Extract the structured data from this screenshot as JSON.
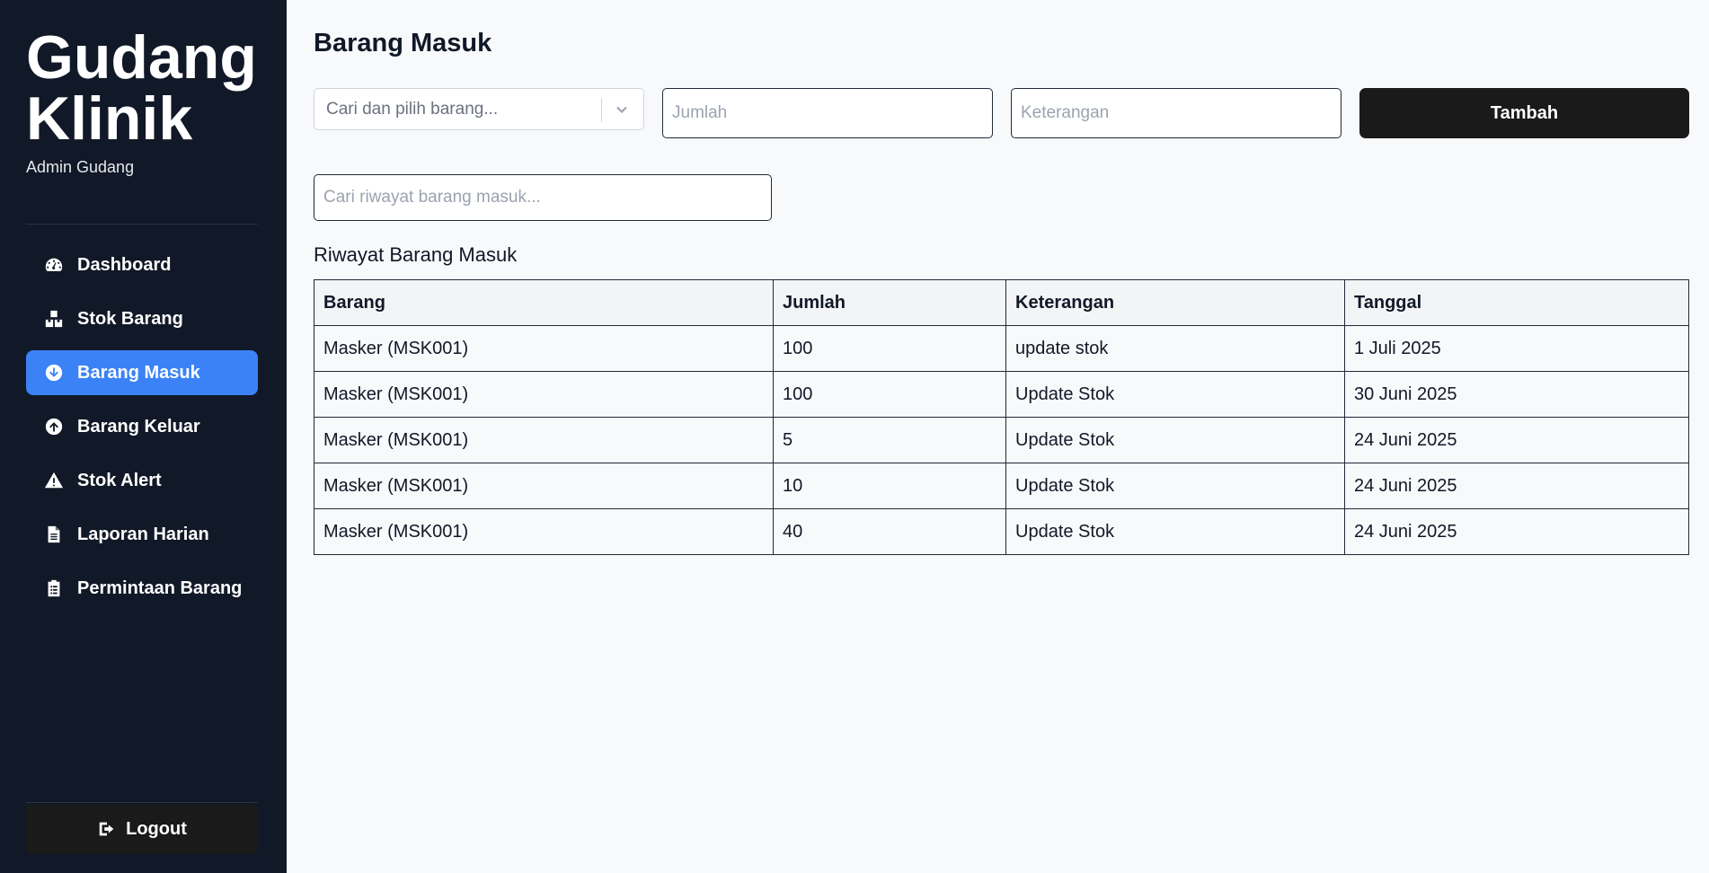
{
  "sidebar": {
    "brand_line1": "Gudang",
    "brand_line2": "Klinik",
    "role": "Admin Gudang",
    "items": [
      {
        "label": "Dashboard",
        "icon": "dashboard-icon"
      },
      {
        "label": "Stok Barang",
        "icon": "boxes-icon"
      },
      {
        "label": "Barang Masuk",
        "icon": "arrow-circle-down-icon",
        "active": true
      },
      {
        "label": "Barang Keluar",
        "icon": "arrow-circle-up-icon"
      },
      {
        "label": "Stok Alert",
        "icon": "warning-icon"
      },
      {
        "label": "Laporan Harian",
        "icon": "document-icon"
      },
      {
        "label": "Permintaan Barang",
        "icon": "clipboard-icon"
      }
    ],
    "logout_label": "Logout",
    "active_color": "#3b82f6",
    "background_color": "#111827"
  },
  "main": {
    "title": "Barang Masuk",
    "form": {
      "select_placeholder": "Cari dan pilih barang...",
      "jumlah_placeholder": "Jumlah",
      "keterangan_placeholder": "Keterangan",
      "submit_label": "Tambah"
    },
    "history_search_placeholder": "Cari riwayat barang masuk...",
    "section_title": "Riwayat Barang Masuk",
    "table": {
      "headers": [
        "Barang",
        "Jumlah",
        "Keterangan",
        "Tanggal"
      ],
      "rows": [
        [
          "Masker (MSK001)",
          "100",
          "update stok",
          "1 Juli 2025"
        ],
        [
          "Masker (MSK001)",
          "100",
          "Update Stok",
          "30 Juni 2025"
        ],
        [
          "Masker (MSK001)",
          "5",
          "Update Stok",
          "24 Juni 2025"
        ],
        [
          "Masker (MSK001)",
          "10",
          "Update Stok",
          "24 Juni 2025"
        ],
        [
          "Masker (MSK001)",
          "40",
          "Update Stok",
          "24 Juni 2025"
        ]
      ]
    }
  }
}
